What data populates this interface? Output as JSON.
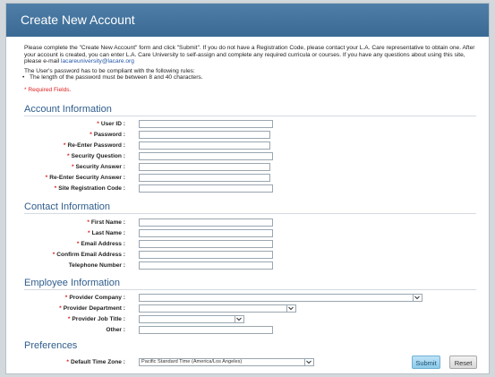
{
  "window": {
    "title": "Create New Account"
  },
  "intro": {
    "paragraph": "Please complete the \"Create New Account\" form and click \"Submit\". If you do not have a Registration Code, please contact your L.A. Care representative to obtain one. After your account is created, you can enter L.A. Care University to self-assign and complete any required curricula or courses. If you have any questions about using this site, please e-mail ",
    "email": "lacareuniversity@lacare.org",
    "rules_heading": "The User's password has to be compliant with the following rules:",
    "rules": [
      "The length of the password must be between 8 and 40 characters."
    ],
    "required_note": "* Required Fields."
  },
  "account": {
    "heading": "Account Information",
    "fields": [
      {
        "label": "User ID :",
        "required": "*"
      },
      {
        "label": "Password :",
        "required": "*"
      },
      {
        "label": "Re-Enter Password :",
        "required": "*"
      },
      {
        "label": "Security Question :",
        "required": "*"
      },
      {
        "label": "Security Answer :",
        "required": "*"
      },
      {
        "label": "Re-Enter Security Answer :",
        "required": "*"
      },
      {
        "label": "Site Registration Code :",
        "required": "*"
      }
    ]
  },
  "contact": {
    "heading": "Contact Information",
    "fields": [
      {
        "label": "First Name :",
        "required": "*"
      },
      {
        "label": "Last Name :",
        "required": "*"
      },
      {
        "label": "Email Address :",
        "required": "*"
      },
      {
        "label": "Confirm Email Address :",
        "required": "*"
      },
      {
        "label": "Telephone Number :",
        "required": ""
      }
    ]
  },
  "employee": {
    "heading": "Employee Information",
    "fields": [
      {
        "label": "Provider Company :",
        "required": "*"
      },
      {
        "label": "Provider Department :",
        "required": "*"
      },
      {
        "label": "Provider Job Title :",
        "required": "*"
      },
      {
        "label": "Other :",
        "required": ""
      }
    ]
  },
  "preferences": {
    "heading": "Preferences",
    "timezone_label": "Default Time Zone :",
    "timezone_required": "*",
    "timezone_value": "Pacific Standard Time (America/Los Angeles)"
  },
  "buttons": {
    "submit": "Submit",
    "reset": "Reset"
  },
  "colors": {
    "titlebar": "#3f6f98",
    "section_heading": "#2f5d8c",
    "required": "#dd2222",
    "submit_bg": "#a6d6ef"
  }
}
